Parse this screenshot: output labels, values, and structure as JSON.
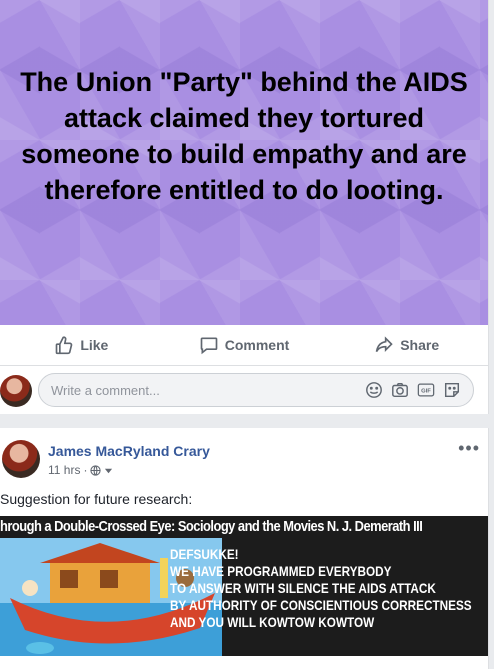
{
  "post": {
    "banner_text": "The Union \"Party\" behind the AIDS attack claimed they tortured someone to build empathy and are therefore entitled to do looting.",
    "background_color": "#a98fe2",
    "actions": {
      "like": "Like",
      "comment": "Comment",
      "share": "Share"
    },
    "comment_placeholder": "Write a comment..."
  },
  "post2": {
    "author": "James MacRyland Crary",
    "time": "11 hrs",
    "text": "Suggestion for future research:",
    "meme_title": "hrough a Double-Crossed Eye: Sociology and the Movies N. J. Demerath III",
    "meme_lines": [
      "DEFSUKKE!",
      "WE HAVE PROGRAMMED EVERYBODY",
      "TO ANSWER WITH SILENCE THE AIDS ATTACK",
      "BY AUTHORITY OF CONSCIENTIOUS CORRECTNESS",
      "AND YOU WILL KOWTOW KOWTOW"
    ]
  },
  "colors": {
    "link": "#365899",
    "meta": "#616770",
    "action": "#606770"
  },
  "icons": [
    "like-icon",
    "comment-icon",
    "share-icon",
    "emoji-icon",
    "camera-icon",
    "gif-icon",
    "sticker-icon",
    "globe-icon",
    "caret-down-icon",
    "more-icon"
  ]
}
